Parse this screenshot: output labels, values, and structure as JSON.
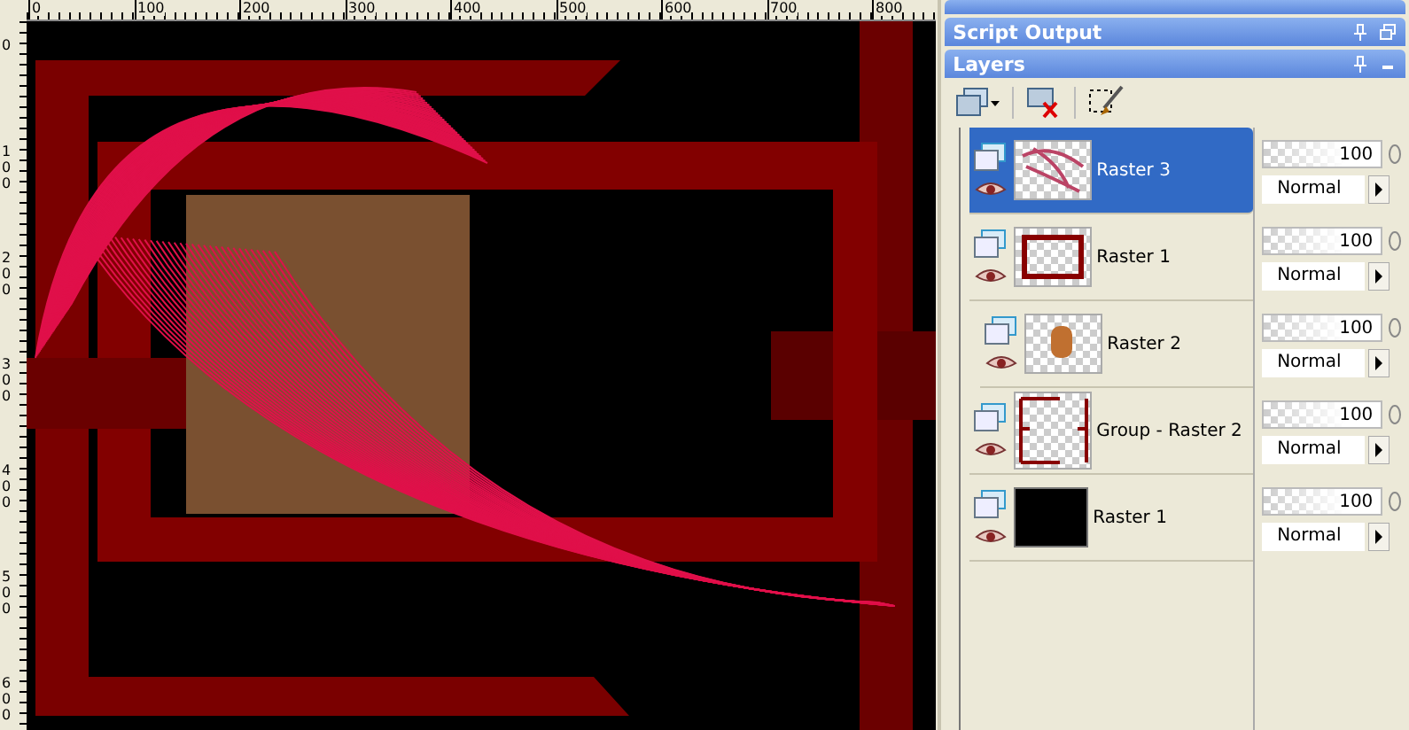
{
  "ruler_top": {
    "labels": [
      "0",
      "100",
      "200",
      "300",
      "400",
      "500",
      "600",
      "700",
      "800"
    ]
  },
  "ruler_left": {
    "labels": [
      "0",
      "100",
      "200",
      "300",
      "400",
      "500",
      "600"
    ]
  },
  "palettes": [
    {
      "title": "Script Output"
    },
    {
      "title": "Layers"
    }
  ],
  "layers": [
    {
      "name": "Raster 3",
      "selected": true,
      "kind": "strokes",
      "opacity": "100",
      "blend_mode": "Normal"
    },
    {
      "name": "Raster 1",
      "selected": false,
      "kind": "frame",
      "opacity": "100",
      "blend_mode": "Normal"
    },
    {
      "name": "Group - Raster 2",
      "selected": false,
      "kind": "group",
      "opacity": "100",
      "blend_mode": "Normal",
      "children": [
        {
          "name": "Raster 2",
          "selected": false,
          "kind": "photo",
          "opacity": "100",
          "blend_mode": "Normal"
        }
      ]
    },
    {
      "name": "Raster 1",
      "selected": false,
      "kind": "black",
      "opacity": "100",
      "blend_mode": "Normal"
    }
  ]
}
